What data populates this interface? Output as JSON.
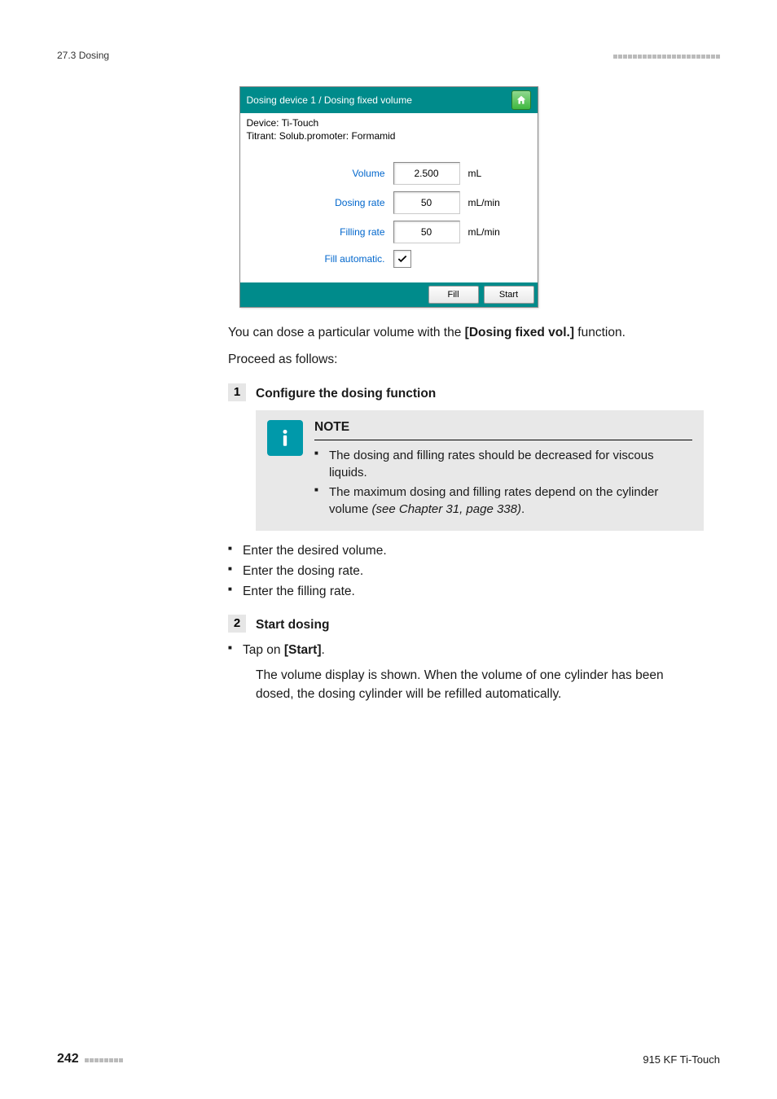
{
  "header": {
    "section": "27.3 Dosing"
  },
  "screenshot": {
    "title": "Dosing device 1 / Dosing fixed volume",
    "device_line": "Device: Ti-Touch",
    "titrant_line": "Titrant: Solub.promoter: Formamid",
    "rows": {
      "volume": {
        "label": "Volume",
        "value": "2.500",
        "unit": "mL"
      },
      "dosing_rate": {
        "label": "Dosing rate",
        "value": "50",
        "unit": "mL/min"
      },
      "filling_rate": {
        "label": "Filling rate",
        "value": "50",
        "unit": "mL/min"
      },
      "fill_auto": {
        "label": "Fill automatic.",
        "checked": true
      }
    },
    "buttons": {
      "fill": "Fill",
      "start": "Start"
    }
  },
  "intro": {
    "p1_a": "You can dose a particular volume with the ",
    "p1_b": "[Dosing fixed vol.]",
    "p1_c": " function.",
    "p2": "Proceed as follows:"
  },
  "steps": {
    "s1": {
      "num": "1",
      "title": "Configure the dosing function",
      "note_heading": "NOTE",
      "note_items": [
        "The dosing and filling rates should be decreased for viscous liquids.",
        "The maximum dosing and filling rates depend on the cylinder volume "
      ],
      "note_ref": "(see Chapter 31, page 338)",
      "note_ref_after": ".",
      "actions": [
        "Enter the desired volume.",
        "Enter the dosing rate.",
        "Enter the filling rate."
      ]
    },
    "s2": {
      "num": "2",
      "title": "Start dosing",
      "action_prefix": "Tap on ",
      "action_bold": "[Start]",
      "action_suffix": ".",
      "result": "The volume display is shown. When the volume of one cylinder has been dosed, the dosing cylinder will be refilled automatically."
    }
  },
  "footer": {
    "page": "242",
    "doc": "915 KF Ti-Touch"
  }
}
